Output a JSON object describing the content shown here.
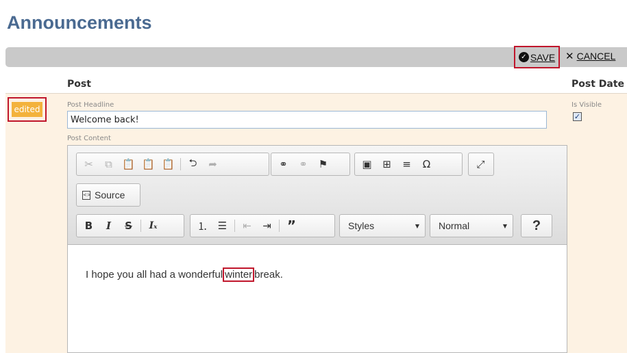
{
  "page": {
    "title": "Announcements"
  },
  "actions": {
    "save_label": "SAVE",
    "cancel_label": "CANCEL"
  },
  "columns": {
    "post": "Post",
    "post_date": "Post Date"
  },
  "row": {
    "status": "edited",
    "headline_label": "Post Headline",
    "headline_value": "Welcome back!",
    "content_label": "Post Content",
    "visible_label": "Is Visible",
    "is_visible": true
  },
  "editor": {
    "source_label": "Source",
    "styles_label": "Styles",
    "format_label": "Normal",
    "help_label": "?",
    "content": {
      "before": "I hope you all had a wonderful",
      "highlight": "winter",
      "after": "break."
    }
  },
  "colors": {
    "title": "#4a6a91",
    "highlight": "#c0152b",
    "badge": "#f3b23c",
    "row_bg": "#fdf2e3"
  }
}
